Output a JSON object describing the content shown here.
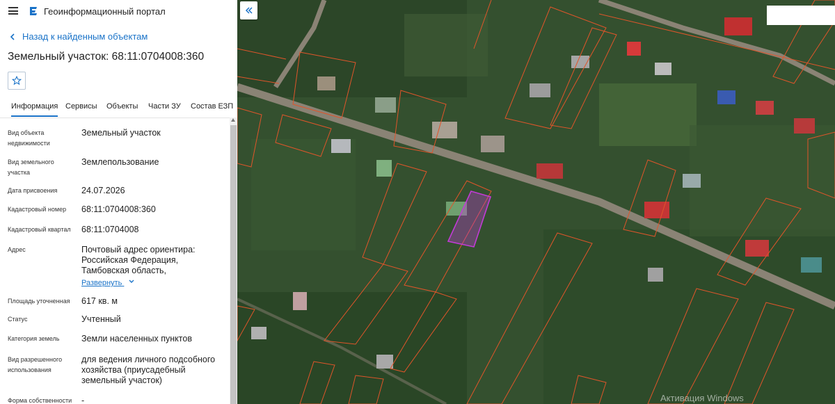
{
  "app": {
    "title": "Геоинформационный портал"
  },
  "nav": {
    "back_label": "Назад к найденным объектам"
  },
  "page": {
    "title": "Земельный участок: 68:11:0704008:360"
  },
  "tabs": [
    {
      "label": "Информация"
    },
    {
      "label": "Сервисы"
    },
    {
      "label": "Объекты"
    },
    {
      "label": "Части ЗУ"
    },
    {
      "label": "Состав ЕЗП"
    }
  ],
  "info": {
    "object_type": {
      "label": "Вид объекта недвижимости",
      "value": "Земельный участок"
    },
    "parcel_type": {
      "label": "Вид земельного участка",
      "value": "Землепользование"
    },
    "assign_date": {
      "label": "Дата присвоения",
      "value": "24.07.2026"
    },
    "cadastral_number": {
      "label": "Кадастровый номер",
      "value": "68:11:0704008:360"
    },
    "cadastral_quarter": {
      "label": "Кадастровый квартал",
      "value": "68:11:0704008"
    },
    "address": {
      "label": "Адрес",
      "value": "Почтовый адрес ориентира: Российская Федерация, Тамбовская область, муниципальный округ",
      "expand_label": "Развернуть"
    },
    "area": {
      "label": "Площадь уточненная",
      "value": "617 кв. м"
    },
    "status": {
      "label": "Статус",
      "value": "Учтенный"
    },
    "land_category": {
      "label": "Категория земель",
      "value": "Земли населенных пунктов"
    },
    "permitted_use": {
      "label": "Вид разрешенного использования",
      "value": "для ведения личного подсобного хозяйства (приусадебный земельный участок)"
    },
    "ownership": {
      "label": "Форма собственности",
      "value": "-"
    }
  },
  "map": {
    "watermark": "Активация Windows"
  },
  "colors": {
    "accent": "#1a73c8",
    "parcel_border": "#e0552a",
    "selected_parcel": "#c23bd6"
  }
}
